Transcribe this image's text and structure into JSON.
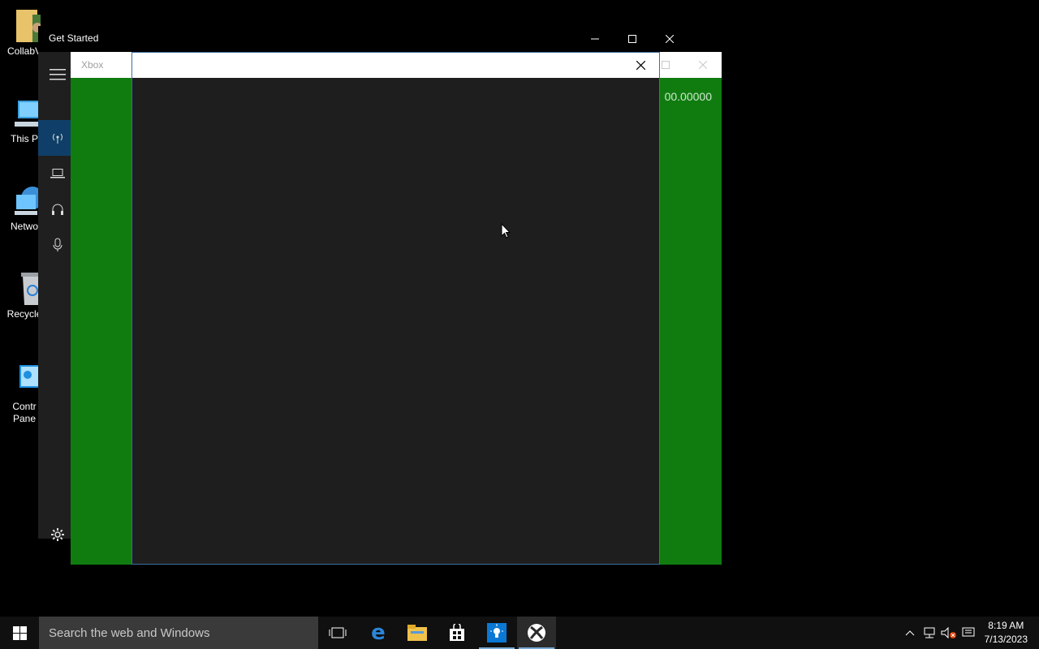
{
  "desktop": {
    "icons": [
      {
        "label": "CollabV",
        "name": "collab-folder-icon"
      },
      {
        "label": "This P",
        "name": "this-pc-icon"
      },
      {
        "label": "Netwo",
        "name": "network-icon"
      },
      {
        "label": "Recycle",
        "name": "recycle-bin-icon"
      },
      {
        "label": "Contr\nPane",
        "line1": "Contr",
        "line2": "Pane",
        "name": "control-panel-icon"
      }
    ]
  },
  "get_started": {
    "title": "Get Started",
    "rail_items": [
      {
        "name": "antenna-icon",
        "active": true
      },
      {
        "name": "laptop-icon",
        "active": false
      },
      {
        "name": "headphones-icon",
        "active": false
      },
      {
        "name": "microphone-icon",
        "active": false
      }
    ],
    "settings_icon": "gear-icon"
  },
  "xbox": {
    "title": "Xbox",
    "value": "00.00000"
  },
  "dialog": {
    "close_icon": "close-icon"
  },
  "taskbar": {
    "search_placeholder": "Search the web and Windows",
    "apps": [
      "start-icon",
      "task-view-icon",
      "edge-icon",
      "file-explorer-icon",
      "store-icon",
      "get-started-icon",
      "xbox-icon"
    ],
    "time": "8:19 AM",
    "date": "7/13/2023"
  },
  "colors": {
    "xbox_green": "#107c10",
    "accent_blue": "#0078d7"
  }
}
